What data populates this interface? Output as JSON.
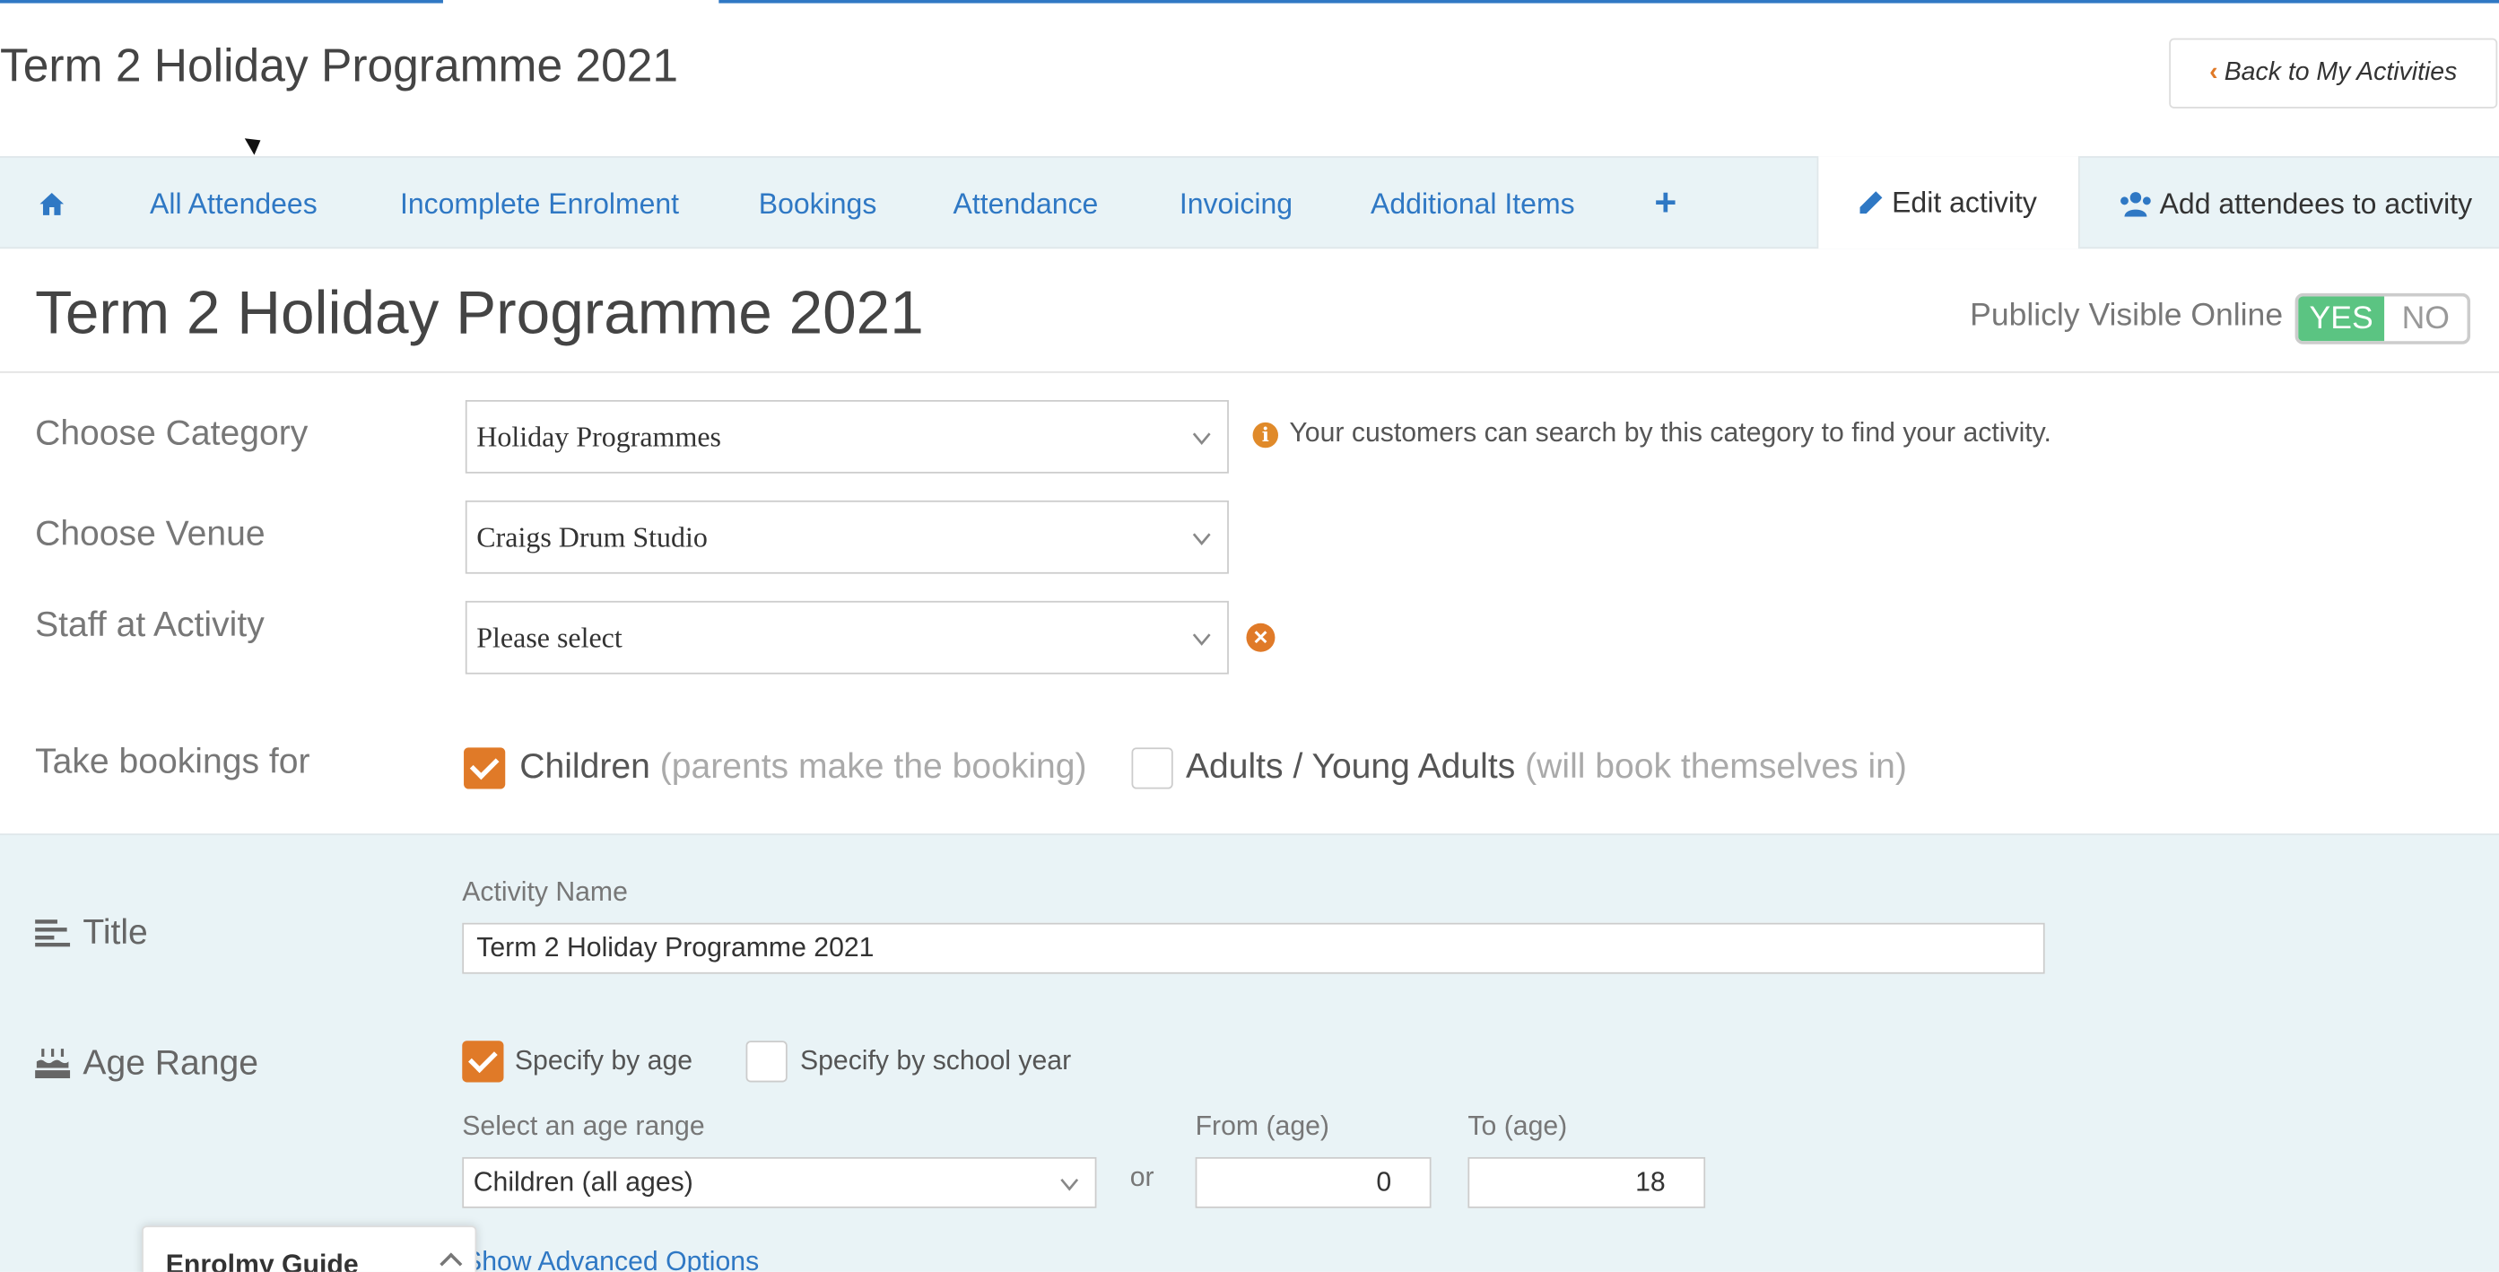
{
  "header": {
    "title": "Term 2 Holiday Programme 2021",
    "back_button": "Back to My Activities"
  },
  "tabs": {
    "items": [
      "All Attendees",
      "Incomplete Enrolment",
      "Bookings",
      "Attendance",
      "Invoicing",
      "Additional Items"
    ],
    "add": "+",
    "edit_activity": "Edit activity",
    "add_attendees": "Add attendees to activity"
  },
  "activity": {
    "title": "Term 2 Holiday Programme 2021",
    "visibility_label": "Publicly Visible Online",
    "visibility_yes": "YES",
    "visibility_no": "NO",
    "visibility_value": "YES"
  },
  "form": {
    "category_label": "Choose Category",
    "category_value": "Holiday Programmes",
    "category_info": "Your customers can search by this category to find your activity.",
    "venue_label": "Choose Venue",
    "venue_value": "Craigs Drum Studio",
    "staff_label": "Staff at Activity",
    "staff_value": "Please select",
    "bookings_label": "Take bookings for",
    "children_label": "Children",
    "children_hint": "(parents make the booking)",
    "children_checked": true,
    "adults_label": "Adults / Young Adults",
    "adults_hint": "(will book themselves in)",
    "adults_checked": false
  },
  "title_section": {
    "label": "Title",
    "activity_name_label": "Activity Name",
    "activity_name_value": "Term 2 Holiday Programme 2021"
  },
  "age_section": {
    "label": "Age Range",
    "by_age_label": "Specify by age",
    "by_age_checked": true,
    "by_school_year_label": "Specify by school year",
    "by_school_year_checked": false,
    "age_range_label": "Select an age range",
    "age_range_value": "Children (all ages)",
    "or_text": "or",
    "from_label": "From (age)",
    "from_value": "0",
    "to_label": "To (age)",
    "to_value": "18",
    "advanced_link": "Show Advanced Options"
  },
  "guide": {
    "title": "Enrolmy Guide"
  },
  "colors": {
    "accent": "#e07a28",
    "link": "#2f78c4",
    "toggle_on": "#5bc482",
    "panel_bg": "#e9f3f6"
  }
}
